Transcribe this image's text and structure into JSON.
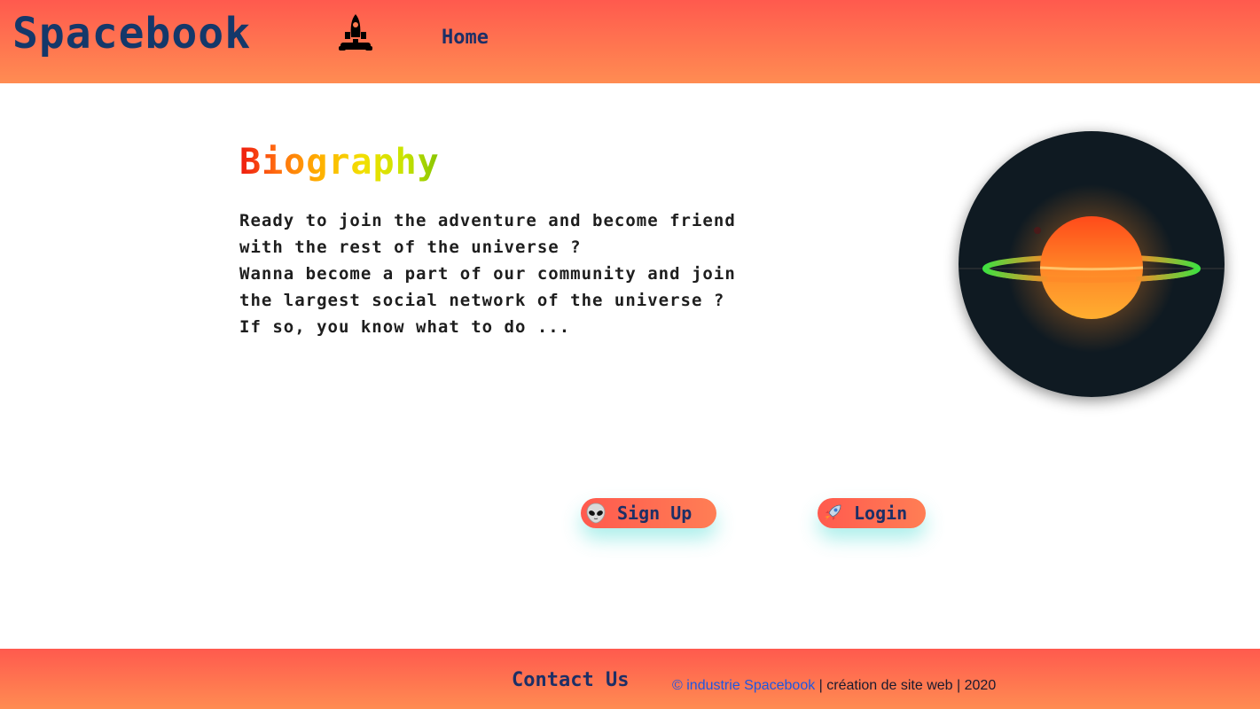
{
  "header": {
    "brand": "Spacebook",
    "brand_icon": "rocket-icon",
    "nav_home": "Home",
    "colors": {
      "gradient_top": "#ff5a4e",
      "gradient_bottom": "#ff8c52",
      "brand": "#14386a"
    }
  },
  "main": {
    "title": "Biography",
    "paragraph_lines": [
      "Ready to join the adventure and become friend",
      "with the rest of the universe ?",
      "Wanna become a part of our community and join",
      "the largest social network of the universe ?",
      "If so, you know what to do ..."
    ],
    "planet_image": "planet-illustration"
  },
  "actions": {
    "signup": {
      "icon": "alien-icon",
      "label": "Sign Up"
    },
    "login": {
      "icon": "rocket-icon",
      "label": "Login"
    }
  },
  "footer": {
    "contact": "Contact Us",
    "copyright_link": "© industrie Spacebook",
    "copyright_rest": " | création de site web | 2020"
  }
}
